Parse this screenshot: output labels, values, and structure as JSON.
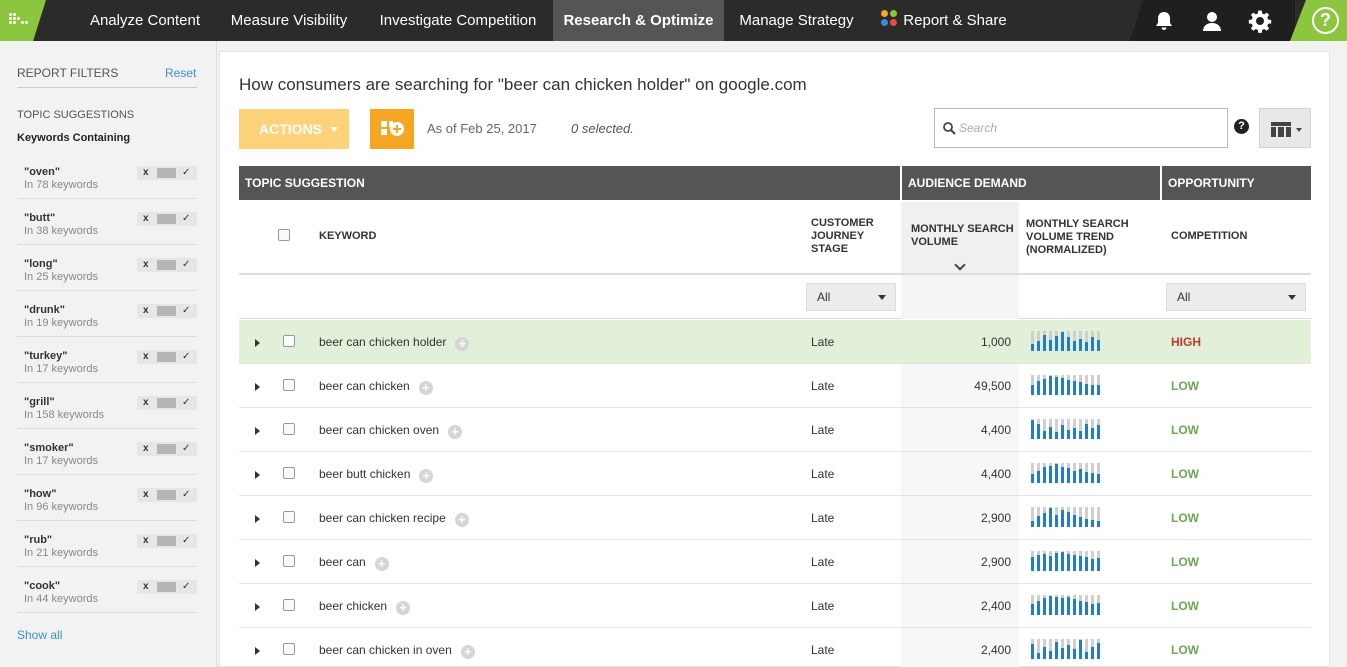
{
  "nav": {
    "items": [
      {
        "label": "Analyze Content",
        "active": false
      },
      {
        "label": "Measure Visibility",
        "active": false
      },
      {
        "label": "Investigate Competition",
        "active": false
      },
      {
        "label": "Research & Optimize",
        "active": true
      },
      {
        "label": "Manage Strategy",
        "active": false
      },
      {
        "label": "Report & Share",
        "active": false
      }
    ],
    "help_label": "?",
    "icons": [
      "bell-icon",
      "user-icon",
      "gear-icon",
      "help-icon"
    ],
    "brand_color": "#8cc63f"
  },
  "sidebar": {
    "title": "REPORT FILTERS",
    "reset_label": "Reset",
    "section": "TOPIC SUGGESTIONS",
    "subsection": "Keywords Containing",
    "filters": [
      {
        "term": "\"oven\"",
        "count": "In 78 keywords"
      },
      {
        "term": "\"butt\"",
        "count": "In 38 keywords"
      },
      {
        "term": "\"long\"",
        "count": "In 25 keywords"
      },
      {
        "term": "\"drunk\"",
        "count": "In 19 keywords"
      },
      {
        "term": "\"turkey\"",
        "count": "In 17 keywords"
      },
      {
        "term": "\"grill\"",
        "count": "In 158 keywords"
      },
      {
        "term": "\"smoker\"",
        "count": "In 17 keywords"
      },
      {
        "term": "\"how\"",
        "count": "In 96 keywords"
      },
      {
        "term": "\"rub\"",
        "count": "In 21 keywords"
      },
      {
        "term": "\"cook\"",
        "count": "In 44 keywords"
      }
    ],
    "toggle_exclude": "x",
    "toggle_include": "✓",
    "show_all_label": "Show all"
  },
  "main": {
    "title": "How consumers are searching for \"beer can chicken holder\" on google.com",
    "actions_label": "ACTIONS",
    "as_of": "As of Feb 25, 2017",
    "selected": "0 selected.",
    "search_placeholder": "Search",
    "help_label": "?"
  },
  "table": {
    "groups": [
      "TOPIC SUGGESTION",
      "AUDIENCE DEMAND",
      "OPPORTUNITY"
    ],
    "columns": {
      "keyword": "KEYWORD",
      "stage": "CUSTOMER JOURNEY STAGE",
      "volume": "MONTHLY SEARCH VOLUME",
      "trend": "MONTHLY SEARCH VOLUME TREND (NORMALIZED)",
      "competition": "COMPETITION"
    },
    "stage_filter": "All",
    "competition_filter": "All",
    "rows": [
      {
        "keyword": "beer can chicken holder",
        "stage": "Late",
        "volume": "1,000",
        "competition": "HIGH",
        "trend": [
          0.35,
          0.5,
          0.8,
          0.55,
          0.75,
          0.95,
          0.7,
          0.5,
          0.6,
          0.45,
          0.7,
          0.55
        ],
        "highlight": true
      },
      {
        "keyword": "beer can chicken",
        "stage": "Late",
        "volume": "49,500",
        "competition": "LOW",
        "trend": [
          0.5,
          0.7,
          0.8,
          0.95,
          0.9,
          0.85,
          0.75,
          0.7,
          0.65,
          0.55,
          0.5,
          0.5
        ],
        "highlight": false
      },
      {
        "keyword": "beer can chicken oven",
        "stage": "Late",
        "volume": "4,400",
        "competition": "LOW",
        "trend": [
          0.95,
          0.75,
          0.4,
          0.6,
          0.35,
          0.7,
          0.45,
          0.55,
          0.4,
          0.75,
          0.55,
          0.7
        ],
        "highlight": false
      },
      {
        "keyword": "beer butt chicken",
        "stage": "Late",
        "volume": "4,400",
        "competition": "LOW",
        "trend": [
          0.45,
          0.6,
          0.8,
          0.85,
          0.95,
          0.8,
          0.75,
          0.6,
          0.7,
          0.55,
          0.5,
          0.45
        ],
        "highlight": false
      },
      {
        "keyword": "beer can chicken recipe",
        "stage": "Late",
        "volume": "2,900",
        "competition": "LOW",
        "trend": [
          0.3,
          0.55,
          0.7,
          0.95,
          0.6,
          0.85,
          0.75,
          0.6,
          0.5,
          0.4,
          0.35,
          0.3
        ],
        "highlight": false
      },
      {
        "keyword": "beer can",
        "stage": "Late",
        "volume": "2,900",
        "competition": "LOW",
        "trend": [
          0.7,
          0.8,
          0.85,
          0.75,
          0.9,
          0.95,
          0.85,
          0.8,
          0.75,
          0.7,
          0.6,
          0.65
        ],
        "highlight": false
      },
      {
        "keyword": "beer chicken",
        "stage": "Late",
        "volume": "2,400",
        "competition": "LOW",
        "trend": [
          0.55,
          0.7,
          0.85,
          0.95,
          0.9,
          0.85,
          0.9,
          0.8,
          0.7,
          0.65,
          0.55,
          0.6
        ],
        "highlight": false
      },
      {
        "keyword": "beer can chicken in oven",
        "stage": "Late",
        "volume": "2,400",
        "competition": "LOW",
        "trend": [
          0.75,
          0.3,
          0.6,
          0.4,
          0.85,
          0.55,
          0.7,
          0.5,
          0.95,
          0.35,
          0.6,
          0.8
        ],
        "highlight": false
      }
    ]
  },
  "colors": {
    "high": "#c0392b",
    "low": "#6aa84f",
    "spark_bar": "#1f7fc0",
    "spark_bg": "#cfcfcf",
    "actions_bg": "#fcd27a",
    "add_btn": "#f5a623"
  }
}
